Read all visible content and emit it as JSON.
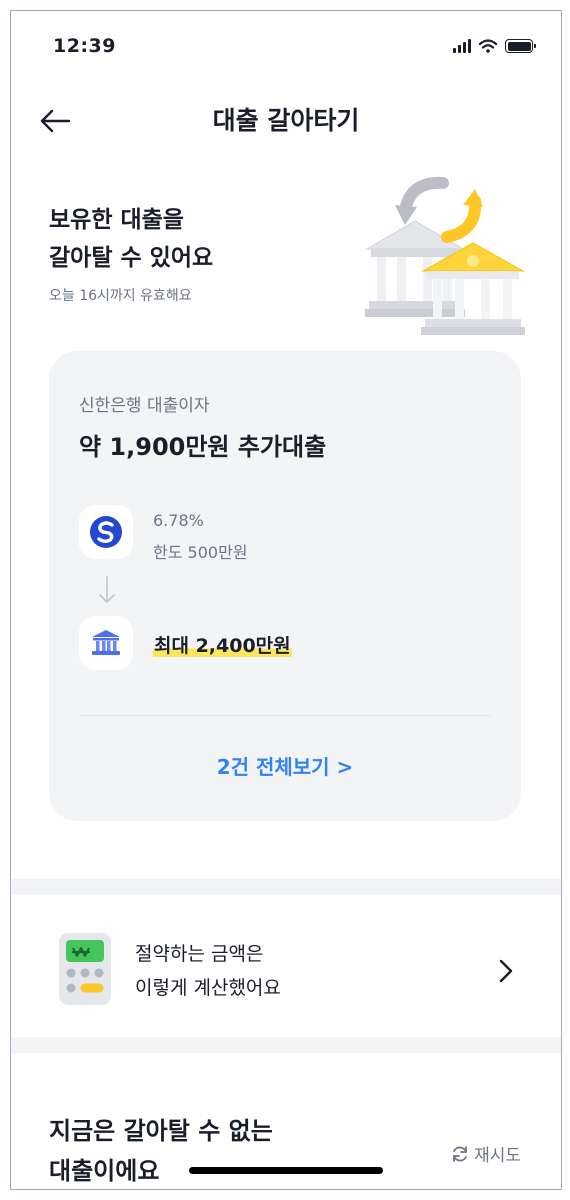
{
  "status_bar": {
    "time": "12:39"
  },
  "nav": {
    "title": "대출 갈아타기"
  },
  "hero": {
    "title": "보유한 대출을\n갈아탈 수 있어요",
    "subtitle": "오늘 16시까지 유효해요"
  },
  "offer_card": {
    "subtitle": "신한은행 대출이자",
    "title": "약 1,900만원 추가대출",
    "current_loan": {
      "rate": "6.78%",
      "limit": "한도 500만원"
    },
    "new_loan": {
      "max_limit": "최대 2,400만원"
    },
    "view_all_label": "2건 전체보기 >"
  },
  "calc_row": {
    "text": "절약하는 금액은\n이렇게 계산했어요"
  },
  "bottom": {
    "title": "지금은 갈아탈 수 없는\n대출이에요",
    "retry_label": "재시도"
  },
  "colors": {
    "accent_blue": "#3182f6",
    "highlight_yellow": "#ffe55a",
    "card_bg": "#f2f4f6",
    "shinhan_blue": "#2449d1"
  }
}
